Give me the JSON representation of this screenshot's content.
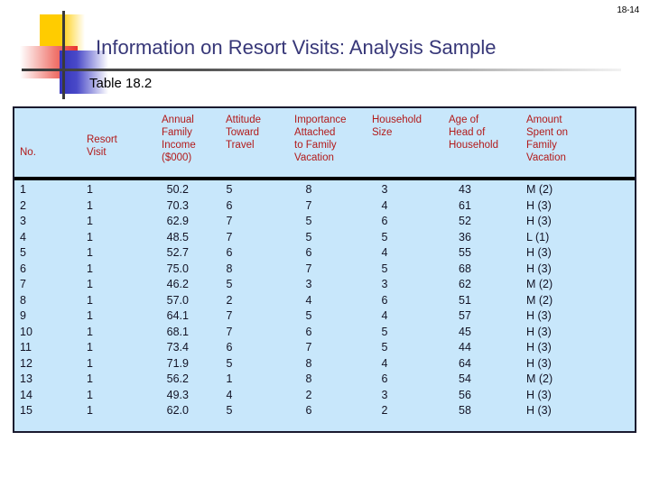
{
  "slide": {
    "page_number": "18-14",
    "title": "Information on Resort Visits: Analysis Sample",
    "subtitle": "Table 18.2",
    "title_color": "#373778",
    "header_text_color": "#b21a1a",
    "table_background": "#c8e7fb",
    "body_text_color": "#131325"
  },
  "table": {
    "headers": [
      "No.",
      "Resort\nVisit",
      "Annual\nFamily\nIncome\n($000)",
      "Attitude\nToward\nTravel",
      "Importance\nAttached\nto Family\nVacation",
      "Household\nSize",
      "Age of\nHead of\nHousehold",
      "Amount\nSpent on\nFamily\nVacation"
    ],
    "rows": [
      [
        "1",
        "1",
        "50.2",
        "5",
        "8",
        "3",
        "43",
        "M (2)"
      ],
      [
        "2",
        "1",
        "70.3",
        "6",
        "7",
        "4",
        "61",
        "H (3)"
      ],
      [
        "3",
        "1",
        "62.9",
        "7",
        "5",
        "6",
        "52",
        "H (3)"
      ],
      [
        "4",
        "1",
        "48.5",
        "7",
        "5",
        "5",
        "36",
        "L (1)"
      ],
      [
        "5",
        "1",
        "52.7",
        "6",
        "6",
        "4",
        "55",
        "H (3)"
      ],
      [
        "6",
        "1",
        "75.0",
        "8",
        "7",
        "5",
        "68",
        "H (3)"
      ],
      [
        "7",
        "1",
        "46.2",
        "5",
        "3",
        "3",
        "62",
        "M (2)"
      ],
      [
        "8",
        "1",
        "57.0",
        "2",
        "4",
        "6",
        "51",
        "M (2)"
      ],
      [
        "9",
        "1",
        "64.1",
        "7",
        "5",
        "4",
        "57",
        "H (3)"
      ],
      [
        "10",
        "1",
        "68.1",
        "7",
        "6",
        "5",
        "45",
        "H (3)"
      ],
      [
        "11",
        "1",
        "73.4",
        "6",
        "7",
        "5",
        "44",
        "H (3)"
      ],
      [
        "12",
        "1",
        "71.9",
        "5",
        "8",
        "4",
        "64",
        "H (3)"
      ],
      [
        "13",
        "1",
        "56.2",
        "1",
        "8",
        "6",
        "54",
        "M (2)"
      ],
      [
        "14",
        "1",
        "49.3",
        "4",
        "2",
        "3",
        "56",
        "H (3)"
      ],
      [
        "15",
        "1",
        "62.0",
        "5",
        "6",
        "2",
        "58",
        "H (3)"
      ]
    ]
  }
}
